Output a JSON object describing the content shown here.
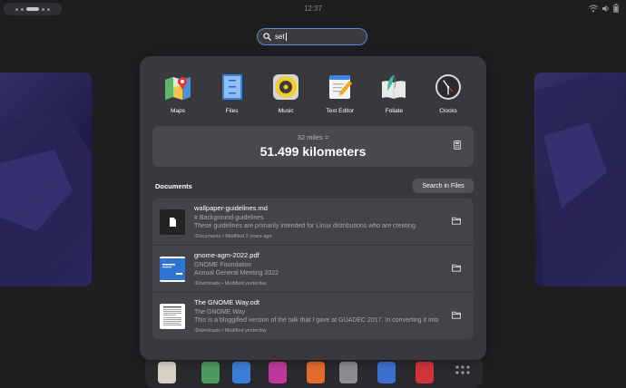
{
  "topbar": {
    "clock": "12:37"
  },
  "search": {
    "value": "set"
  },
  "apps": [
    {
      "name": "Maps",
      "icon": "maps-icon"
    },
    {
      "name": "Files",
      "icon": "files-icon"
    },
    {
      "name": "Music",
      "icon": "music-icon"
    },
    {
      "name": "Text Editor",
      "icon": "text-editor-icon"
    },
    {
      "name": "Foliate",
      "icon": "foliate-icon"
    },
    {
      "name": "Clocks",
      "icon": "clocks-icon"
    }
  ],
  "calculator": {
    "query": "32 miles =",
    "answer": "51.499 kilometers",
    "icon": "calculator-icon"
  },
  "documents": {
    "title": "Documents",
    "search_button": "Search in Files",
    "results": [
      {
        "title": "wallpaper-guidelines.md",
        "line1": "# Background guidelines",
        "line2": "These guidelines are primarily intended for Linux distributions who are creating",
        "meta": "/Documents • Modified 2 years ago",
        "thumb": "text-file-icon"
      },
      {
        "title": "gnome-agm-2022.pdf",
        "line1": "GNOME Foundation",
        "line2": "Annual General Meeting 2022",
        "meta": "/Downloads • Modified yesterday",
        "thumb": "slide-thumbnail"
      },
      {
        "title": "The GNOME Way.odt",
        "line1": "The GNOME Way",
        "line2": "This is a bloggified version of the talk that I gave at GUADEC 2017. In converting it into",
        "meta": "/Downloads • Modified yesterday",
        "thumb": "document-thumbnail"
      }
    ]
  },
  "colors": {
    "accent": "#5b8bd6",
    "panel": "#38383d",
    "card": "#48484d",
    "background": "#1e1e21"
  }
}
